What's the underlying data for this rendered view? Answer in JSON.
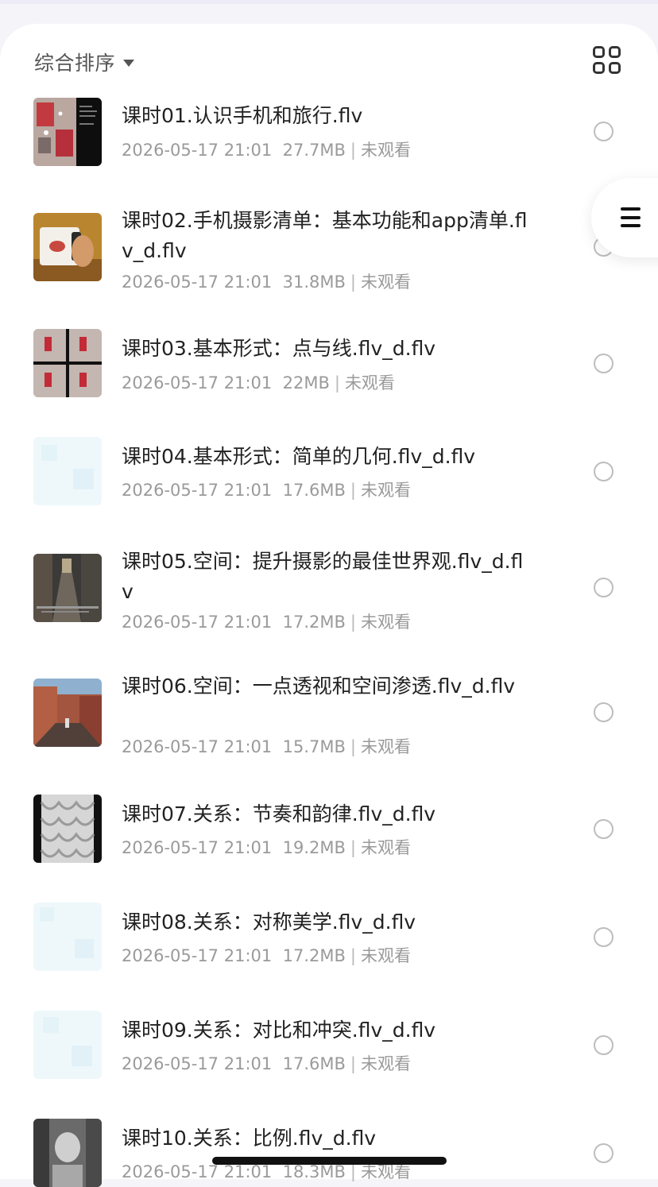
{
  "toolbar": {
    "sort_label": "综合排序",
    "sort_icon": "caret-down-icon",
    "view_toggle_icon": "grid-view-icon",
    "menu_icon": "hamburger-menu-icon"
  },
  "files": [
    {
      "title": "课时01.认识手机和旅行.flv",
      "date": "2026-05-17 21:01",
      "size": "27.7MB",
      "status": "未观看",
      "thumb": "pigeons-collage"
    },
    {
      "title": "课时02.手机摄影清单：基本功能和app清单.flv_d.flv",
      "date": "2026-05-17 21:01",
      "size": "31.8MB",
      "status": "未观看",
      "thumb": "hand-holding-phone"
    },
    {
      "title": "课时03.基本形式：点与线.flv_d.flv",
      "date": "2026-05-17 21:01",
      "size": "22MB",
      "status": "未观看",
      "thumb": "quad-pigeons"
    },
    {
      "title": "课时04.基本形式：简单的几何.flv_d.flv",
      "date": "2026-05-17 21:01",
      "size": "17.6MB",
      "status": "未观看",
      "thumb": "blank"
    },
    {
      "title": "课时05.空间：提升摄影的最佳世界观.flv_d.flv",
      "date": "2026-05-17 21:01",
      "size": "17.2MB",
      "status": "未观看",
      "thumb": "street-alley"
    },
    {
      "title": "课时06.空间：一点透视和空间渗透.flv_d.flv",
      "date": "2026-05-17 21:01",
      "size": "15.7MB",
      "status": "未观看",
      "thumb": "town-street"
    },
    {
      "title": "课时07.关系：节奏和韵律.flv_d.flv",
      "date": "2026-05-17 21:01",
      "size": "19.2MB",
      "status": "未观看",
      "thumb": "scale-pattern"
    },
    {
      "title": "课时08.关系：对称美学.flv_d.flv",
      "date": "2026-05-17 21:01",
      "size": "17.2MB",
      "status": "未观看",
      "thumb": "blank"
    },
    {
      "title": "课时09.关系：对比和冲突.flv_d.flv",
      "date": "2026-05-17 21:01",
      "size": "17.6MB",
      "status": "未观看",
      "thumb": "blank"
    },
    {
      "title": "课时10.关系：比例.flv_d.flv",
      "date": "2026-05-17 21:01",
      "size": "18.3MB",
      "status": "未观看",
      "thumb": "bw-portrait"
    }
  ]
}
